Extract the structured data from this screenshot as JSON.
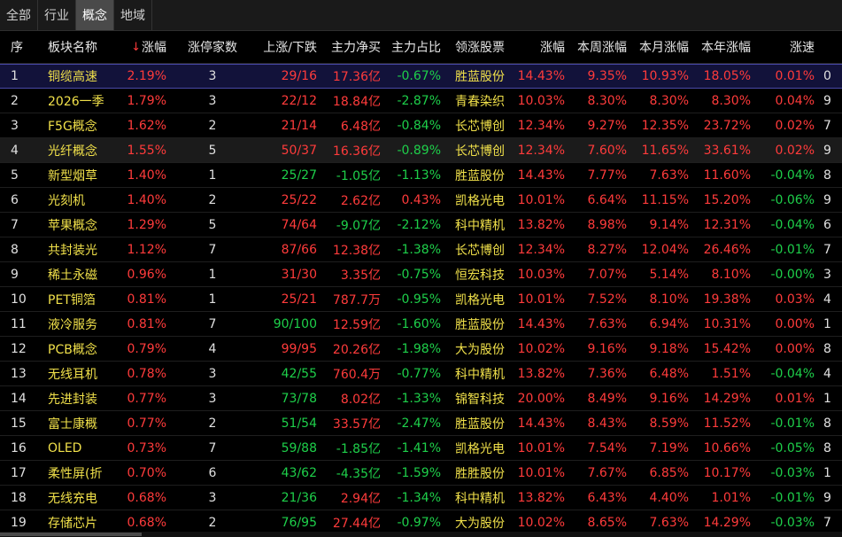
{
  "tabs": [
    {
      "label": "全部"
    },
    {
      "label": "行业"
    },
    {
      "label": "概念"
    },
    {
      "label": "地域"
    }
  ],
  "active_tab": 2,
  "colors": {
    "up": "#ff3b3b",
    "down": "#1ecf4a",
    "name": "#f0e04a",
    "selected_row": "#12123a"
  },
  "header": {
    "seq": "序",
    "name": "板块名称",
    "pct": "涨幅",
    "pct_sort_icon": "sort-down-icon",
    "limit_count": "涨停家数",
    "updown": "上涨/下跌",
    "net": "主力净买",
    "ratio": "主力占比",
    "lead_stock": "领涨股票",
    "stock_pct": "涨幅",
    "week": "本周涨幅",
    "month": "本月涨幅",
    "year": "本年涨幅",
    "speed": "涨速"
  },
  "rows": [
    {
      "seq": "1",
      "name": "铜缆高速",
      "pct": "2.19%",
      "limit": "3",
      "updown": "29/16",
      "net": "17.36亿",
      "ratio": "-0.67%",
      "stock": "胜蓝股份",
      "sp": "14.43%",
      "week": "9.35%",
      "month": "10.93%",
      "year": "18.05%",
      "speed": "0.01%",
      "extra": "0"
    },
    {
      "seq": "2",
      "name": "2026一季",
      "pct": "1.79%",
      "limit": "3",
      "updown": "22/12",
      "net": "18.84亿",
      "ratio": "-2.87%",
      "stock": "青春染织",
      "sp": "10.03%",
      "week": "8.30%",
      "month": "8.30%",
      "year": "8.30%",
      "speed": "0.04%",
      "extra": "9"
    },
    {
      "seq": "3",
      "name": "F5G概念",
      "pct": "1.62%",
      "limit": "2",
      "updown": "21/14",
      "net": "6.48亿",
      "ratio": "-0.84%",
      "stock": "长芯博创",
      "sp": "12.34%",
      "week": "9.27%",
      "month": "12.35%",
      "year": "23.72%",
      "speed": "0.02%",
      "extra": "7"
    },
    {
      "seq": "4",
      "name": "光纤概念",
      "pct": "1.55%",
      "limit": "5",
      "updown": "50/37",
      "net": "16.36亿",
      "ratio": "-0.89%",
      "stock": "长芯博创",
      "sp": "12.34%",
      "week": "7.60%",
      "month": "11.65%",
      "year": "33.61%",
      "speed": "0.02%",
      "extra": "9"
    },
    {
      "seq": "5",
      "name": "新型烟草",
      "pct": "1.40%",
      "limit": "1",
      "updown": "25/27",
      "net": "-1.05亿",
      "ratio": "-1.13%",
      "stock": "胜蓝股份",
      "sp": "14.43%",
      "week": "7.77%",
      "month": "7.63%",
      "year": "11.60%",
      "speed": "-0.04%",
      "extra": "8"
    },
    {
      "seq": "6",
      "name": "光刻机",
      "pct": "1.40%",
      "limit": "2",
      "updown": "25/22",
      "net": "2.62亿",
      "ratio": "0.43%",
      "stock": "凯格光电",
      "sp": "10.01%",
      "week": "6.64%",
      "month": "11.15%",
      "year": "15.20%",
      "speed": "-0.06%",
      "extra": "9"
    },
    {
      "seq": "7",
      "name": "苹果概念",
      "pct": "1.29%",
      "limit": "5",
      "updown": "74/64",
      "net": "-9.07亿",
      "ratio": "-2.12%",
      "stock": "科中精机",
      "sp": "13.82%",
      "week": "8.98%",
      "month": "9.14%",
      "year": "12.31%",
      "speed": "-0.04%",
      "extra": "6"
    },
    {
      "seq": "8",
      "name": "共封装光",
      "pct": "1.12%",
      "limit": "7",
      "updown": "87/66",
      "net": "12.38亿",
      "ratio": "-1.38%",
      "stock": "长芯博创",
      "sp": "12.34%",
      "week": "8.27%",
      "month": "12.04%",
      "year": "26.46%",
      "speed": "-0.01%",
      "extra": "7"
    },
    {
      "seq": "9",
      "name": "稀土永磁",
      "pct": "0.96%",
      "limit": "1",
      "updown": "31/30",
      "net": "3.35亿",
      "ratio": "-0.75%",
      "stock": "恒宏科技",
      "sp": "10.03%",
      "week": "7.07%",
      "month": "5.14%",
      "year": "8.10%",
      "speed": "-0.00%",
      "extra": "3"
    },
    {
      "seq": "10",
      "name": "PET铜箔",
      "pct": "0.81%",
      "limit": "1",
      "updown": "25/21",
      "net": "787.7万",
      "ratio": "-0.95%",
      "stock": "凯格光电",
      "sp": "10.01%",
      "week": "7.52%",
      "month": "8.10%",
      "year": "19.38%",
      "speed": "0.03%",
      "extra": "4"
    },
    {
      "seq": "11",
      "name": "液冷服务",
      "pct": "0.81%",
      "limit": "7",
      "updown": "90/100",
      "net": "12.59亿",
      "ratio": "-1.60%",
      "stock": "胜蓝股份",
      "sp": "14.43%",
      "week": "7.63%",
      "month": "6.94%",
      "year": "10.31%",
      "speed": "0.00%",
      "extra": "1"
    },
    {
      "seq": "12",
      "name": "PCB概念",
      "pct": "0.79%",
      "limit": "4",
      "updown": "99/95",
      "net": "20.26亿",
      "ratio": "-1.98%",
      "stock": "大为股份",
      "sp": "10.02%",
      "week": "9.16%",
      "month": "9.18%",
      "year": "15.42%",
      "speed": "0.00%",
      "extra": "8"
    },
    {
      "seq": "13",
      "name": "无线耳机",
      "pct": "0.78%",
      "limit": "3",
      "updown": "42/55",
      "net": "760.4万",
      "ratio": "-0.77%",
      "stock": "科中精机",
      "sp": "13.82%",
      "week": "7.36%",
      "month": "6.48%",
      "year": "1.51%",
      "speed": "-0.04%",
      "extra": "4"
    },
    {
      "seq": "14",
      "name": "先进封装",
      "pct": "0.77%",
      "limit": "3",
      "updown": "73/78",
      "net": "8.02亿",
      "ratio": "-1.33%",
      "stock": "锦智科技",
      "sp": "20.00%",
      "week": "8.49%",
      "month": "9.16%",
      "year": "14.29%",
      "speed": "0.01%",
      "extra": "1"
    },
    {
      "seq": "15",
      "name": "富士康概",
      "pct": "0.77%",
      "limit": "2",
      "updown": "51/54",
      "net": "33.57亿",
      "ratio": "-2.47%",
      "stock": "胜蓝股份",
      "sp": "14.43%",
      "week": "8.43%",
      "month": "8.59%",
      "year": "11.52%",
      "speed": "-0.01%",
      "extra": "8"
    },
    {
      "seq": "16",
      "name": "OLED",
      "pct": "0.73%",
      "limit": "7",
      "updown": "59/88",
      "net": "-1.85亿",
      "ratio": "-1.41%",
      "stock": "凯格光电",
      "sp": "10.01%",
      "week": "7.54%",
      "month": "7.19%",
      "year": "10.66%",
      "speed": "-0.05%",
      "extra": "8"
    },
    {
      "seq": "17",
      "name": "柔性屏(折",
      "pct": "0.70%",
      "limit": "6",
      "updown": "43/62",
      "net": "-4.35亿",
      "ratio": "-1.59%",
      "stock": "胜胜股份",
      "sp": "10.01%",
      "week": "7.67%",
      "month": "6.85%",
      "year": "10.17%",
      "speed": "-0.03%",
      "extra": "1"
    },
    {
      "seq": "18",
      "name": "无线充电",
      "pct": "0.68%",
      "limit": "3",
      "updown": "21/36",
      "net": "2.94亿",
      "ratio": "-1.34%",
      "stock": "科中精机",
      "sp": "13.82%",
      "week": "6.43%",
      "month": "4.40%",
      "year": "1.01%",
      "speed": "-0.01%",
      "extra": "9"
    },
    {
      "seq": "19",
      "name": "存储芯片",
      "pct": "0.68%",
      "limit": "2",
      "updown": "76/95",
      "net": "27.44亿",
      "ratio": "-0.97%",
      "stock": "大为股份",
      "sp": "10.02%",
      "week": "8.65%",
      "month": "7.63%",
      "year": "14.29%",
      "speed": "-0.03%",
      "extra": "7"
    }
  ]
}
